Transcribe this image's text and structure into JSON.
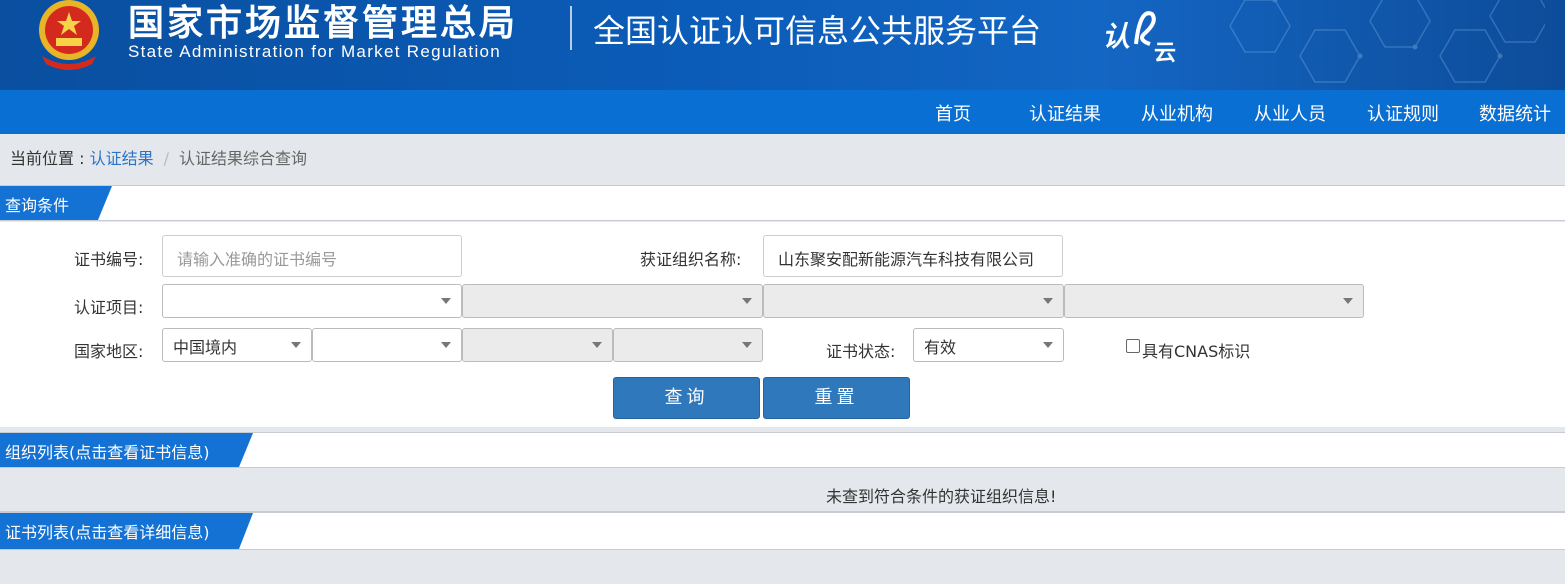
{
  "header": {
    "agency_cn": "国家市场监督管理总局",
    "agency_en": "State Administration  for  Market Regulation",
    "platform_title": "全国认证认可信息公共服务平台",
    "logo_text": "认e云"
  },
  "nav": {
    "items": [
      {
        "label": "首页"
      },
      {
        "label": "认证结果"
      },
      {
        "label": "从业机构"
      },
      {
        "label": "从业人员"
      },
      {
        "label": "认证规则"
      },
      {
        "label": "数据统计"
      }
    ]
  },
  "breadcrumb": {
    "prefix": "当前位置 : ",
    "parent": "认证结果",
    "separator": "/",
    "current": "认证结果综合查询"
  },
  "query": {
    "section_title": "查询条件",
    "cert_no_label": "证书编号:",
    "cert_no_placeholder": "请输入准确的证书编号",
    "org_name_label": "获证组织名称:",
    "org_name_value": "山东聚安配新能源汽车科技有限公司",
    "project_label": "认证项目:",
    "region_label": "国家地区:",
    "region_value": "中国境内",
    "status_label": "证书状态:",
    "status_value": "有效",
    "cnas_label": "具有CNAS标识",
    "search_button": "查询",
    "reset_button": "重置"
  },
  "org_list": {
    "section_title": "组织列表(点击查看证书信息)",
    "empty_message": "未查到符合条件的获证组织信息!"
  },
  "cert_list": {
    "section_title": "证书列表(点击查看详细信息)"
  }
}
